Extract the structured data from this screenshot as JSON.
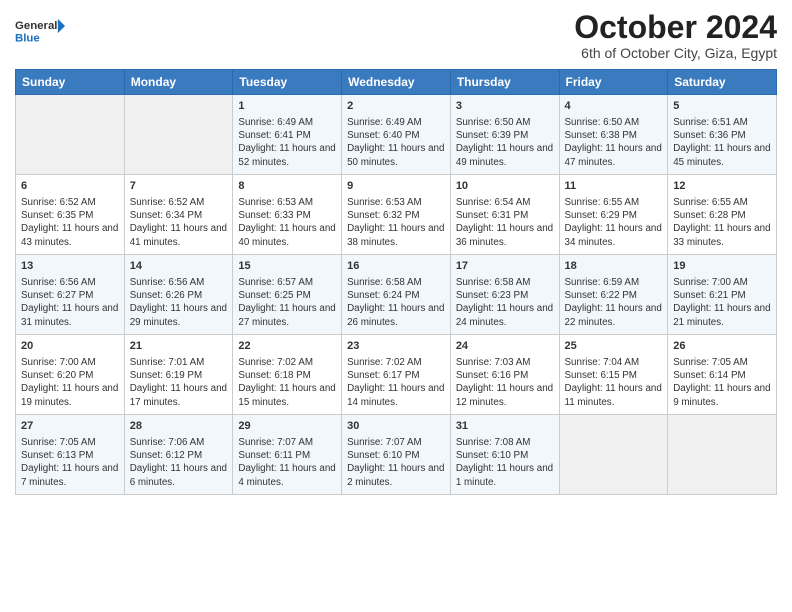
{
  "logo": {
    "line1": "General",
    "line2": "Blue"
  },
  "title": "October 2024",
  "subtitle": "6th of October City, Giza, Egypt",
  "headers": [
    "Sunday",
    "Monday",
    "Tuesday",
    "Wednesday",
    "Thursday",
    "Friday",
    "Saturday"
  ],
  "weeks": [
    [
      {
        "day": "",
        "info": ""
      },
      {
        "day": "",
        "info": ""
      },
      {
        "day": "1",
        "info": "Sunrise: 6:49 AM\nSunset: 6:41 PM\nDaylight: 11 hours and 52 minutes."
      },
      {
        "day": "2",
        "info": "Sunrise: 6:49 AM\nSunset: 6:40 PM\nDaylight: 11 hours and 50 minutes."
      },
      {
        "day": "3",
        "info": "Sunrise: 6:50 AM\nSunset: 6:39 PM\nDaylight: 11 hours and 49 minutes."
      },
      {
        "day": "4",
        "info": "Sunrise: 6:50 AM\nSunset: 6:38 PM\nDaylight: 11 hours and 47 minutes."
      },
      {
        "day": "5",
        "info": "Sunrise: 6:51 AM\nSunset: 6:36 PM\nDaylight: 11 hours and 45 minutes."
      }
    ],
    [
      {
        "day": "6",
        "info": "Sunrise: 6:52 AM\nSunset: 6:35 PM\nDaylight: 11 hours and 43 minutes."
      },
      {
        "day": "7",
        "info": "Sunrise: 6:52 AM\nSunset: 6:34 PM\nDaylight: 11 hours and 41 minutes."
      },
      {
        "day": "8",
        "info": "Sunrise: 6:53 AM\nSunset: 6:33 PM\nDaylight: 11 hours and 40 minutes."
      },
      {
        "day": "9",
        "info": "Sunrise: 6:53 AM\nSunset: 6:32 PM\nDaylight: 11 hours and 38 minutes."
      },
      {
        "day": "10",
        "info": "Sunrise: 6:54 AM\nSunset: 6:31 PM\nDaylight: 11 hours and 36 minutes."
      },
      {
        "day": "11",
        "info": "Sunrise: 6:55 AM\nSunset: 6:29 PM\nDaylight: 11 hours and 34 minutes."
      },
      {
        "day": "12",
        "info": "Sunrise: 6:55 AM\nSunset: 6:28 PM\nDaylight: 11 hours and 33 minutes."
      }
    ],
    [
      {
        "day": "13",
        "info": "Sunrise: 6:56 AM\nSunset: 6:27 PM\nDaylight: 11 hours and 31 minutes."
      },
      {
        "day": "14",
        "info": "Sunrise: 6:56 AM\nSunset: 6:26 PM\nDaylight: 11 hours and 29 minutes."
      },
      {
        "day": "15",
        "info": "Sunrise: 6:57 AM\nSunset: 6:25 PM\nDaylight: 11 hours and 27 minutes."
      },
      {
        "day": "16",
        "info": "Sunrise: 6:58 AM\nSunset: 6:24 PM\nDaylight: 11 hours and 26 minutes."
      },
      {
        "day": "17",
        "info": "Sunrise: 6:58 AM\nSunset: 6:23 PM\nDaylight: 11 hours and 24 minutes."
      },
      {
        "day": "18",
        "info": "Sunrise: 6:59 AM\nSunset: 6:22 PM\nDaylight: 11 hours and 22 minutes."
      },
      {
        "day": "19",
        "info": "Sunrise: 7:00 AM\nSunset: 6:21 PM\nDaylight: 11 hours and 21 minutes."
      }
    ],
    [
      {
        "day": "20",
        "info": "Sunrise: 7:00 AM\nSunset: 6:20 PM\nDaylight: 11 hours and 19 minutes."
      },
      {
        "day": "21",
        "info": "Sunrise: 7:01 AM\nSunset: 6:19 PM\nDaylight: 11 hours and 17 minutes."
      },
      {
        "day": "22",
        "info": "Sunrise: 7:02 AM\nSunset: 6:18 PM\nDaylight: 11 hours and 15 minutes."
      },
      {
        "day": "23",
        "info": "Sunrise: 7:02 AM\nSunset: 6:17 PM\nDaylight: 11 hours and 14 minutes."
      },
      {
        "day": "24",
        "info": "Sunrise: 7:03 AM\nSunset: 6:16 PM\nDaylight: 11 hours and 12 minutes."
      },
      {
        "day": "25",
        "info": "Sunrise: 7:04 AM\nSunset: 6:15 PM\nDaylight: 11 hours and 11 minutes."
      },
      {
        "day": "26",
        "info": "Sunrise: 7:05 AM\nSunset: 6:14 PM\nDaylight: 11 hours and 9 minutes."
      }
    ],
    [
      {
        "day": "27",
        "info": "Sunrise: 7:05 AM\nSunset: 6:13 PM\nDaylight: 11 hours and 7 minutes."
      },
      {
        "day": "28",
        "info": "Sunrise: 7:06 AM\nSunset: 6:12 PM\nDaylight: 11 hours and 6 minutes."
      },
      {
        "day": "29",
        "info": "Sunrise: 7:07 AM\nSunset: 6:11 PM\nDaylight: 11 hours and 4 minutes."
      },
      {
        "day": "30",
        "info": "Sunrise: 7:07 AM\nSunset: 6:10 PM\nDaylight: 11 hours and 2 minutes."
      },
      {
        "day": "31",
        "info": "Sunrise: 7:08 AM\nSunset: 6:10 PM\nDaylight: 11 hours and 1 minute."
      },
      {
        "day": "",
        "info": ""
      },
      {
        "day": "",
        "info": ""
      }
    ]
  ]
}
